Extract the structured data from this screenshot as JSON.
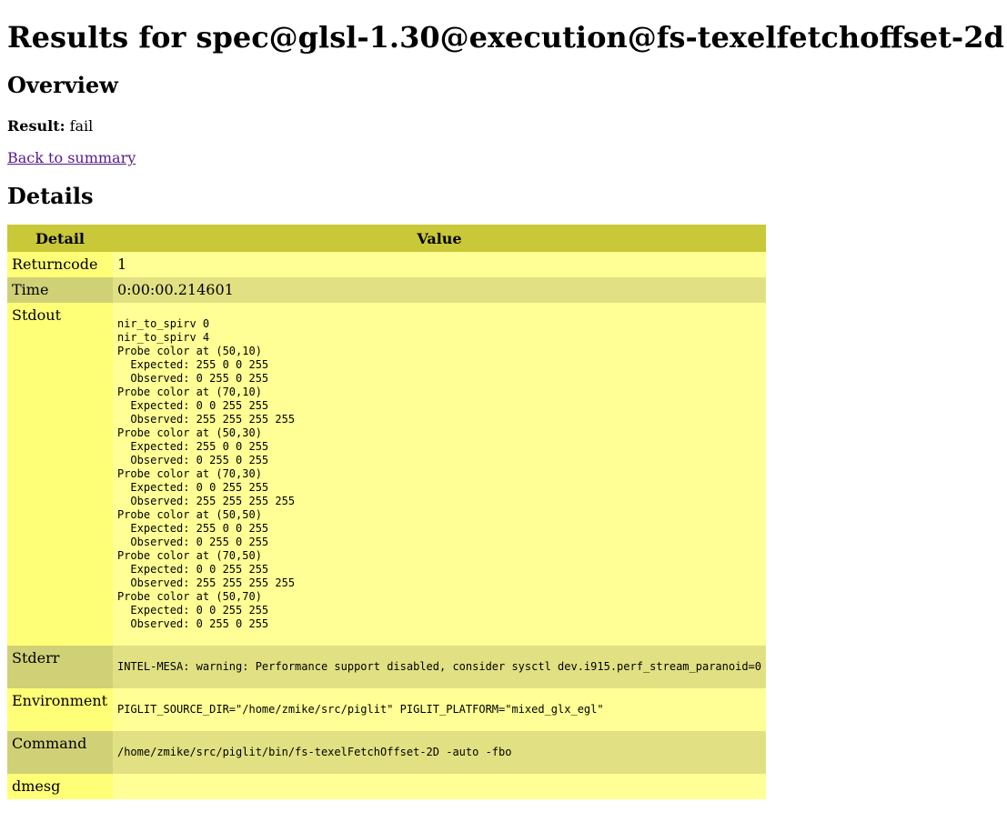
{
  "page": {
    "title": "Results for spec@glsl-1.30@execution@fs-texelfetchoffset-2d",
    "overview_heading": "Overview",
    "result_label": "Result:",
    "result_value": "fail",
    "back_link": "Back to summary",
    "details_heading": "Details"
  },
  "table": {
    "headers": [
      "Detail",
      "Value"
    ],
    "rows": {
      "returncode": {
        "label": "Returncode",
        "value": "1"
      },
      "time": {
        "label": "Time",
        "value": "0:00:00.214601"
      },
      "stdout": {
        "label": "Stdout",
        "value": "nir_to_spirv 0\nnir_to_spirv 4\nProbe color at (50,10)\n  Expected: 255 0 0 255\n  Observed: 0 255 0 255\nProbe color at (70,10)\n  Expected: 0 0 255 255\n  Observed: 255 255 255 255\nProbe color at (50,30)\n  Expected: 255 0 0 255\n  Observed: 0 255 0 255\nProbe color at (70,30)\n  Expected: 0 0 255 255\n  Observed: 255 255 255 255\nProbe color at (50,50)\n  Expected: 255 0 0 255\n  Observed: 0 255 0 255\nProbe color at (70,50)\n  Expected: 0 0 255 255\n  Observed: 255 255 255 255\nProbe color at (50,70)\n  Expected: 0 0 255 255\n  Observed: 0 255 0 255"
      },
      "stderr": {
        "label": "Stderr",
        "value": "INTEL-MESA: warning: Performance support disabled, consider sysctl dev.i915.perf_stream_paranoid=0"
      },
      "environment": {
        "label": "Environment",
        "value": "PIGLIT_SOURCE_DIR=\"/home/zmike/src/piglit\" PIGLIT_PLATFORM=\"mixed_glx_egl\""
      },
      "command": {
        "label": "Command",
        "value": "/home/zmike/src/piglit/bin/fs-texelFetchOffset-2D -auto -fbo"
      },
      "dmesg": {
        "label": "dmesg",
        "value": ""
      }
    }
  },
  "colors": {
    "header_bg": "#c8c838",
    "row_odd": "#ffff95",
    "row_even": "#e1e183",
    "link": "#551a8b"
  }
}
